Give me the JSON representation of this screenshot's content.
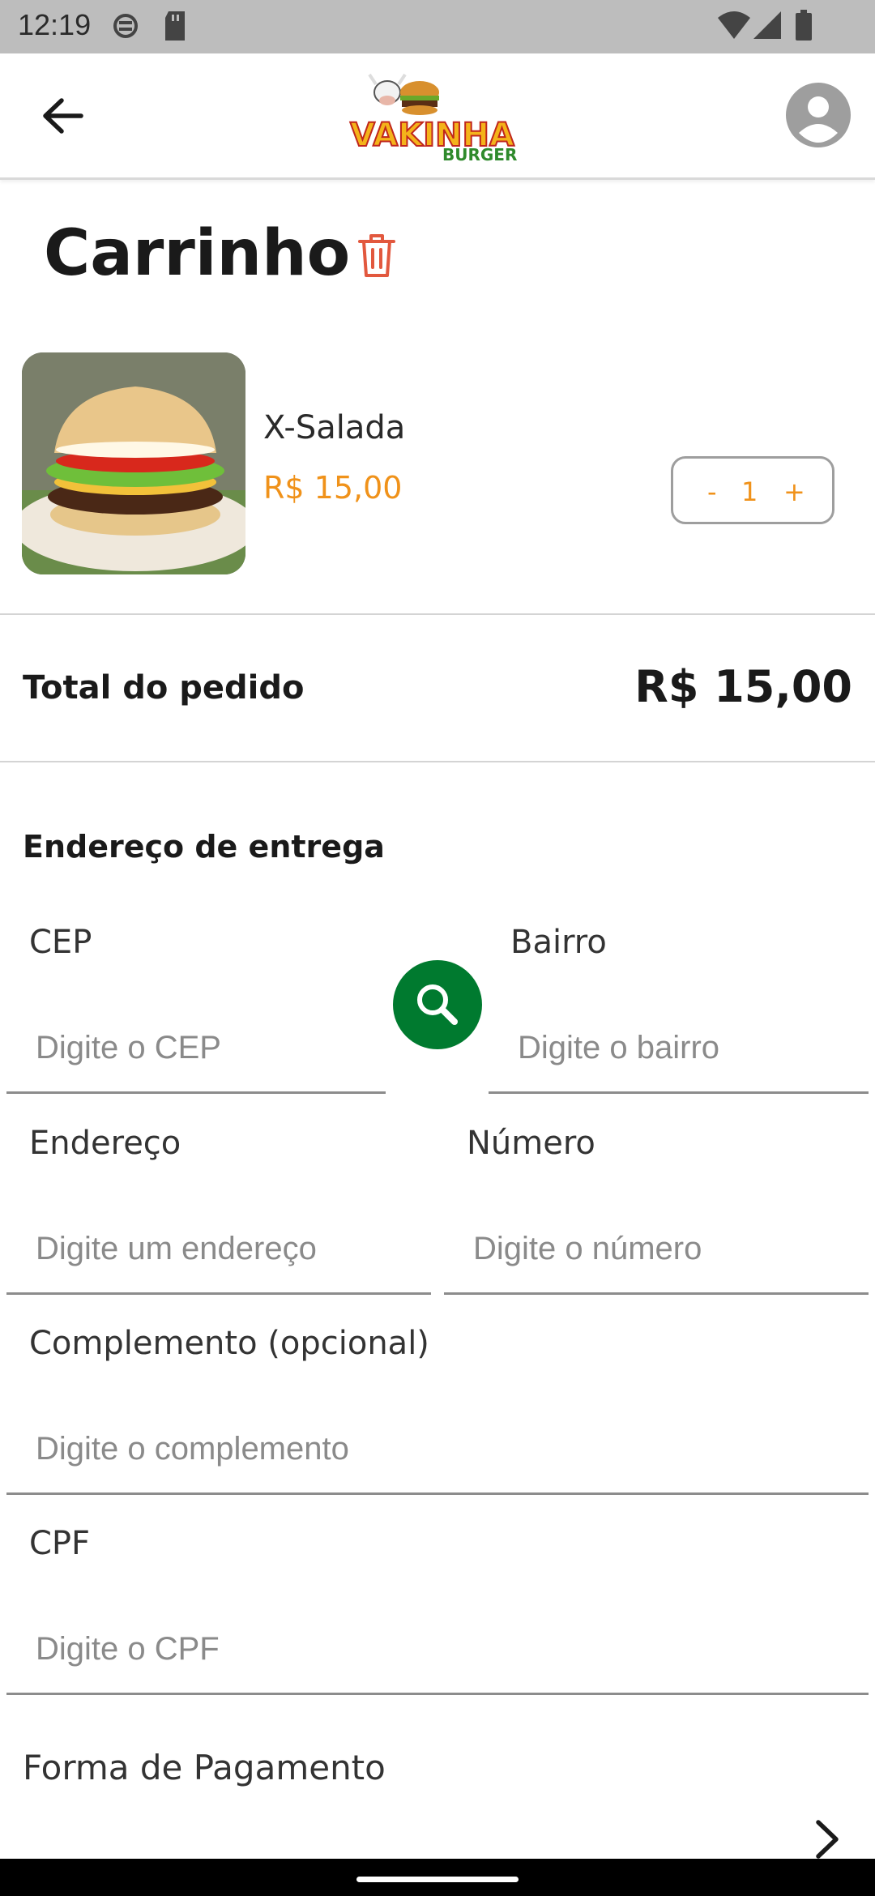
{
  "status": {
    "time": "12:19",
    "left_icons": [
      "sim-icon",
      "sd-card-icon"
    ],
    "right_icons": [
      "wifi-icon",
      "signal-icon",
      "battery-icon"
    ]
  },
  "app_bar": {
    "logo_text": "VAKINHA",
    "logo_subtext": "BURGER",
    "back_icon": "arrow-left-icon",
    "profile_icon": "account-circle-icon"
  },
  "cart": {
    "title": "Carrinho",
    "delete_icon": "trash-icon"
  },
  "items": [
    {
      "name": "X-Salada",
      "price": "R$ 15,00",
      "quantity": "1",
      "minus": "-",
      "plus": "+"
    }
  ],
  "total": {
    "label": "Total do pedido",
    "value": "R$ 15,00"
  },
  "address": {
    "section_title": "Endereço de entrega",
    "cep": {
      "label": "CEP",
      "placeholder": "Digite o CEP"
    },
    "bairro": {
      "label": "Bairro",
      "placeholder": "Digite o bairro"
    },
    "endereco": {
      "label": "Endereço",
      "placeholder": "Digite um endereço"
    },
    "numero": {
      "label": "Número",
      "placeholder": "Digite o número"
    },
    "complemento": {
      "label": "Complemento (opcional)",
      "placeholder": "Digite o complemento"
    },
    "cpf": {
      "label": "CPF",
      "placeholder": "Digite o CPF"
    }
  },
  "payment": {
    "label": "Forma de Pagamento",
    "chevron_icon": "chevron-right-icon"
  },
  "colors": {
    "accent": "#f0921a",
    "search_button": "#007a2f",
    "trash": "#e2583e"
  }
}
